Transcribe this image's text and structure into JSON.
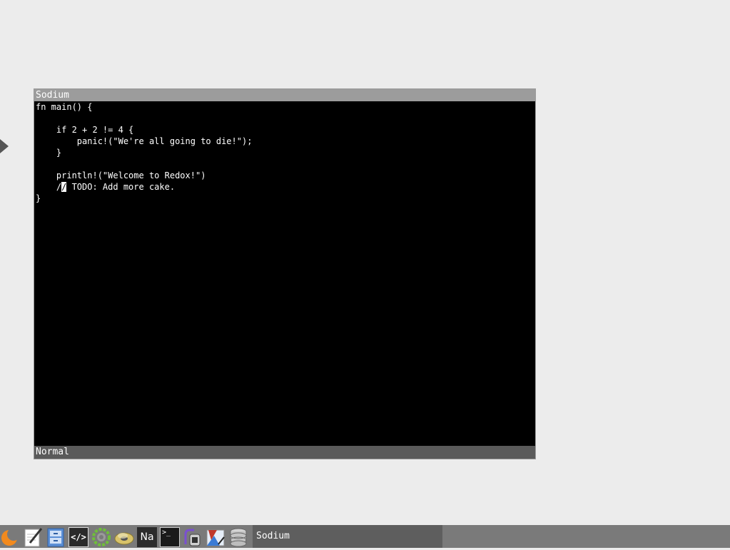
{
  "window": {
    "title": "Sodium",
    "status": "Normal"
  },
  "editor": {
    "lines": [
      "fn main() {",
      "",
      "    if 2 + 2 != 4 {",
      "        panic!(\"We're all going to die!\");",
      "    }",
      "",
      "    println!(\"Welcome to Redox!\")",
      "    / TODO: Add more cake.",
      "}"
    ],
    "caret_line_prefix": "    /",
    "caret_char": "/",
    "caret_line_suffix": " TODO: Add more cake."
  },
  "taskbar": {
    "icons": [
      "launcher-moon-icon",
      "text-editor-pen-icon",
      "file-manager-icon",
      "code-editor-icon",
      "updater-gear-icon",
      "viewer-disc-icon",
      "sodium-na-icon",
      "terminal-icon",
      "system-monitor-icon",
      "paint-icon",
      "database-icon"
    ],
    "na_label": "Na",
    "term_label": ">_",
    "code_label": "</>",
    "active_task": "Sodium"
  },
  "colors": {
    "desktop": "#ececec",
    "titlebar": "#9c9c9c",
    "statusbar": "#5a5a5a",
    "editor_bg": "#000000",
    "taskbar": "#7a7a7a"
  }
}
